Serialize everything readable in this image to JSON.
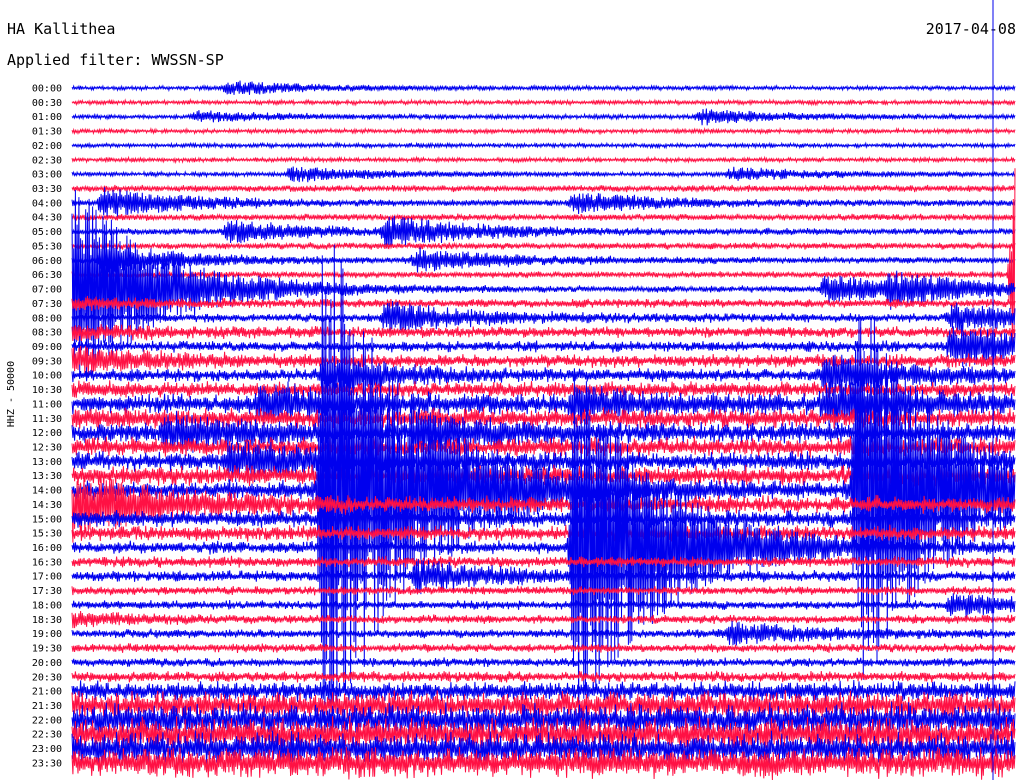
{
  "header": {
    "station": "HA Kallithea",
    "filter": "Applied filter: WWSSN-SP",
    "date": "2017-04-08"
  },
  "chart_data": {
    "type": "line",
    "title": "HA Kallithea",
    "subtitle": "Applied filter: WWSSN-SP",
    "date": "2017-04-08",
    "ylabel": "HHZ - 50000",
    "row_labels": [
      "00:00",
      "00:30",
      "01:00",
      "01:30",
      "02:00",
      "02:30",
      "03:00",
      "03:30",
      "04:00",
      "04:30",
      "05:00",
      "05:30",
      "06:00",
      "06:30",
      "07:00",
      "07:30",
      "08:00",
      "08:30",
      "09:00",
      "09:30",
      "10:00",
      "10:30",
      "11:00",
      "11:30",
      "12:00",
      "12:30",
      "13:00",
      "13:30",
      "14:00",
      "14:30",
      "15:00",
      "15:30",
      "16:00",
      "16:30",
      "17:00",
      "17:30",
      "18:00",
      "18:30",
      "19:00",
      "19:30",
      "20:00",
      "20:30",
      "21:00",
      "21:30",
      "22:00",
      "22:30",
      "23:00",
      "23:30"
    ],
    "row_colors": [
      "#0000ee",
      "#ff1144"
    ],
    "row_noise_level": [
      2,
      2,
      2,
      2,
      2,
      2,
      2,
      3,
      3,
      3,
      3,
      3,
      3,
      3,
      3,
      4,
      4,
      5,
      5,
      6,
      6,
      7,
      9,
      9,
      9,
      9,
      9,
      9,
      9,
      8,
      8,
      7,
      6,
      5,
      5,
      4,
      4,
      4,
      4,
      4,
      4,
      5,
      9,
      13,
      15,
      15,
      15,
      14
    ],
    "events": [
      {
        "time": "00:05",
        "amplitude": 6
      },
      {
        "time": "01:04",
        "amplitude": 5
      },
      {
        "time": "01:20",
        "amplitude": 7
      },
      {
        "time": "03:07",
        "amplitude": 7
      },
      {
        "time": "03:21",
        "amplitude": 6
      },
      {
        "time": "04:01",
        "amplitude": 14
      },
      {
        "time": "04:16",
        "amplitude": 10
      },
      {
        "time": "05:05",
        "amplitude": 10
      },
      {
        "time": "05:10",
        "amplitude": 14
      },
      {
        "time": "06:01",
        "amplitude": 14
      },
      {
        "time": "06:11",
        "amplitude": 10
      },
      {
        "time": "07:00",
        "amplitude": 110
      },
      {
        "time": "07:24",
        "amplitude": 14
      },
      {
        "time": "07:26",
        "amplitude": 12
      },
      {
        "time": "08:10",
        "amplitude": 14
      },
      {
        "time": "08:28",
        "amplitude": 12
      },
      {
        "time": "09:28",
        "amplitude": 22
      },
      {
        "time": "10:08",
        "amplitude": 14
      },
      {
        "time": "10:24",
        "amplitude": 18
      },
      {
        "time": "11:06",
        "amplitude": 16
      },
      {
        "time": "11:16",
        "amplitude": 12
      },
      {
        "time": "11:24",
        "amplitude": 18
      },
      {
        "time": "12:03",
        "amplitude": 14
      },
      {
        "time": "12:11",
        "amplitude": 14
      },
      {
        "time": "13:05",
        "amplitude": 16
      },
      {
        "time": "14:08",
        "amplitude": 280
      },
      {
        "time": "14:25",
        "amplitude": 210
      },
      {
        "time": "16:16",
        "amplitude": 190
      },
      {
        "time": "17:11",
        "amplitude": 14
      },
      {
        "time": "18:28",
        "amplitude": 10
      },
      {
        "time": "19:21",
        "amplitude": 10
      }
    ],
    "cursor_minute_in_row": 29.3
  }
}
